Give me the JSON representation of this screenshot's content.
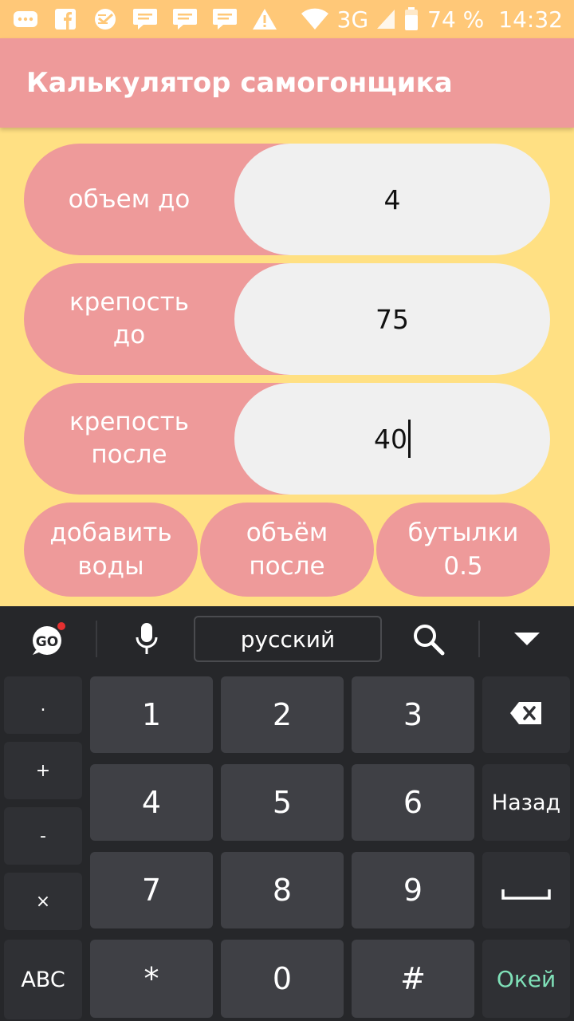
{
  "status_bar": {
    "network": "3G",
    "battery": "74 %",
    "time": "14:32",
    "icons": [
      "chat-icon",
      "facebook-icon",
      "sberbank-icon",
      "message-icon",
      "message-icon",
      "message-icon",
      "warning-icon",
      "wifi-icon",
      "signal-icon",
      "battery-icon"
    ]
  },
  "app": {
    "title": "Калькулятор самогонщика",
    "colors": {
      "background": "#FFE083",
      "accent": "#EE9A9A",
      "status_bar": "#FFC878"
    }
  },
  "fields": [
    {
      "label": "объем до",
      "value": "4"
    },
    {
      "label_line1": "крепость",
      "label_line2": "до",
      "value": "75"
    },
    {
      "label_line1": "крепость",
      "label_line2": "после",
      "value": "40"
    }
  ],
  "buttons": [
    {
      "line1": "добавить",
      "line2": "воды"
    },
    {
      "line1": "объём",
      "line2": "после"
    },
    {
      "line1": "бутылки",
      "line2": "0.5"
    }
  ],
  "keyboard": {
    "language": "русский",
    "toolbar_icons": [
      "go-keyboard-icon",
      "microphone-icon",
      "search-icon",
      "chevron-down-icon"
    ],
    "side_keys": [
      ".",
      "+",
      "-",
      "×",
      "ABC"
    ],
    "digits": [
      "1",
      "2",
      "3",
      "4",
      "5",
      "6",
      "7",
      "8",
      "9",
      "*",
      "0",
      "#"
    ],
    "back_label": "Назад",
    "ok_label": "Окей",
    "icons": [
      "backspace-icon",
      "space-icon"
    ]
  }
}
